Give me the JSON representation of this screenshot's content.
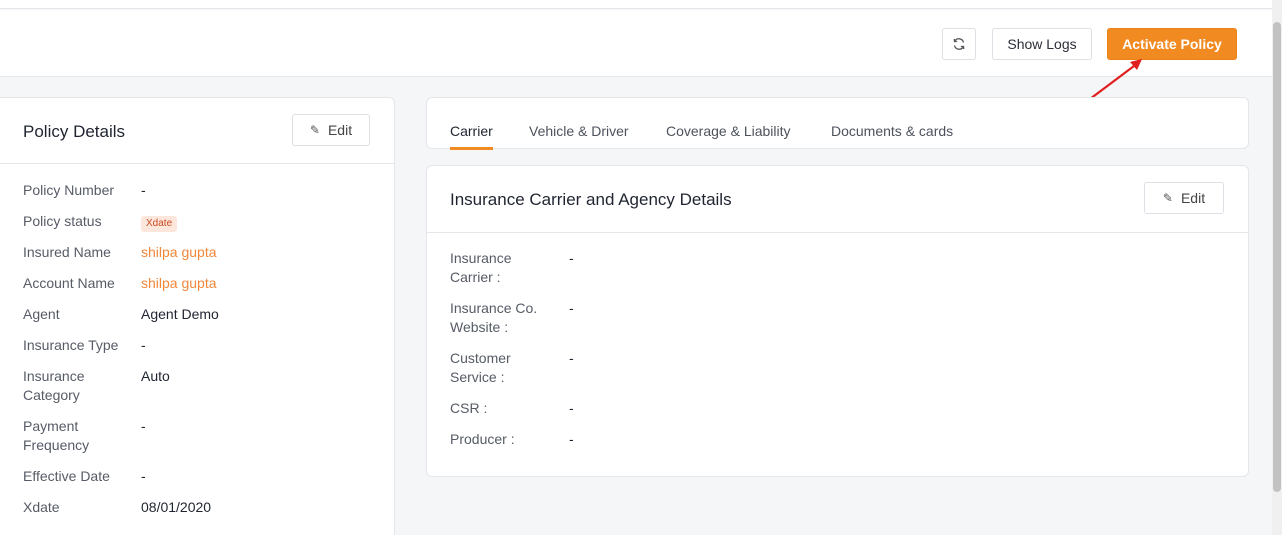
{
  "toolbar": {
    "show_logs": "Show Logs",
    "activate": "Activate Policy"
  },
  "policy": {
    "title": "Policy Details",
    "edit": "Edit",
    "rows": [
      {
        "label": "Policy Number",
        "value": "-"
      },
      {
        "label": "Policy status",
        "value": "Xdate"
      },
      {
        "label": "Insured Name",
        "value": "shilpa gupta"
      },
      {
        "label": "Account Name",
        "value": "shilpa gupta"
      },
      {
        "label": "Agent",
        "value": "Agent Demo"
      },
      {
        "label": "Insurance Type",
        "value": "-"
      },
      {
        "label": "Insurance Category",
        "value": "Auto"
      },
      {
        "label": "Payment Frequency",
        "value": "-"
      },
      {
        "label": "Effective Date",
        "value": "-"
      },
      {
        "label": "Xdate",
        "value": "08/01/2020"
      }
    ]
  },
  "tabs": [
    "Carrier",
    "Vehicle & Driver",
    "Coverage & Liability",
    "Documents & cards"
  ],
  "carrier": {
    "title": "Insurance Carrier and Agency Details",
    "edit": "Edit",
    "rows": [
      {
        "label": "Insurance Carrier :",
        "value": "-"
      },
      {
        "label": "Insurance Co. Website :",
        "value": "-"
      },
      {
        "label": "Customer Service :",
        "value": "-"
      },
      {
        "label": "CSR :",
        "value": "-"
      },
      {
        "label": "Producer :",
        "value": "-"
      }
    ]
  },
  "colors": {
    "accent": "#f28a22",
    "link": "#f0873a",
    "annotation_arrow": "#e01e1e"
  }
}
